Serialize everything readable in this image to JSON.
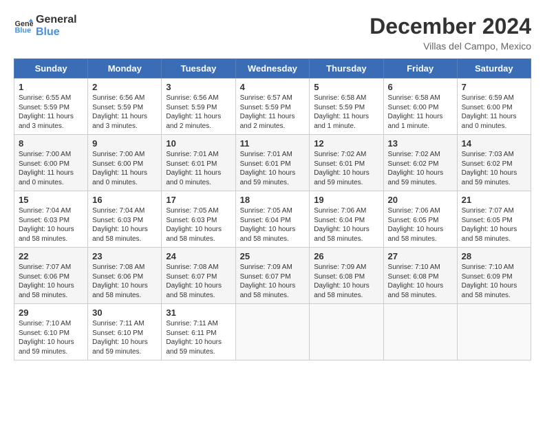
{
  "header": {
    "logo_line1": "General",
    "logo_line2": "Blue",
    "month": "December 2024",
    "location": "Villas del Campo, Mexico"
  },
  "weekdays": [
    "Sunday",
    "Monday",
    "Tuesday",
    "Wednesday",
    "Thursday",
    "Friday",
    "Saturday"
  ],
  "weeks": [
    [
      {
        "day": "1",
        "info": "Sunrise: 6:55 AM\nSunset: 5:59 PM\nDaylight: 11 hours\nand 3 minutes."
      },
      {
        "day": "2",
        "info": "Sunrise: 6:56 AM\nSunset: 5:59 PM\nDaylight: 11 hours\nand 3 minutes."
      },
      {
        "day": "3",
        "info": "Sunrise: 6:56 AM\nSunset: 5:59 PM\nDaylight: 11 hours\nand 2 minutes."
      },
      {
        "day": "4",
        "info": "Sunrise: 6:57 AM\nSunset: 5:59 PM\nDaylight: 11 hours\nand 2 minutes."
      },
      {
        "day": "5",
        "info": "Sunrise: 6:58 AM\nSunset: 5:59 PM\nDaylight: 11 hours\nand 1 minute."
      },
      {
        "day": "6",
        "info": "Sunrise: 6:58 AM\nSunset: 6:00 PM\nDaylight: 11 hours\nand 1 minute."
      },
      {
        "day": "7",
        "info": "Sunrise: 6:59 AM\nSunset: 6:00 PM\nDaylight: 11 hours\nand 0 minutes."
      }
    ],
    [
      {
        "day": "8",
        "info": "Sunrise: 7:00 AM\nSunset: 6:00 PM\nDaylight: 11 hours\nand 0 minutes."
      },
      {
        "day": "9",
        "info": "Sunrise: 7:00 AM\nSunset: 6:00 PM\nDaylight: 11 hours\nand 0 minutes."
      },
      {
        "day": "10",
        "info": "Sunrise: 7:01 AM\nSunset: 6:01 PM\nDaylight: 11 hours\nand 0 minutes."
      },
      {
        "day": "11",
        "info": "Sunrise: 7:01 AM\nSunset: 6:01 PM\nDaylight: 10 hours\nand 59 minutes."
      },
      {
        "day": "12",
        "info": "Sunrise: 7:02 AM\nSunset: 6:01 PM\nDaylight: 10 hours\nand 59 minutes."
      },
      {
        "day": "13",
        "info": "Sunrise: 7:02 AM\nSunset: 6:02 PM\nDaylight: 10 hours\nand 59 minutes."
      },
      {
        "day": "14",
        "info": "Sunrise: 7:03 AM\nSunset: 6:02 PM\nDaylight: 10 hours\nand 59 minutes."
      }
    ],
    [
      {
        "day": "15",
        "info": "Sunrise: 7:04 AM\nSunset: 6:03 PM\nDaylight: 10 hours\nand 58 minutes."
      },
      {
        "day": "16",
        "info": "Sunrise: 7:04 AM\nSunset: 6:03 PM\nDaylight: 10 hours\nand 58 minutes."
      },
      {
        "day": "17",
        "info": "Sunrise: 7:05 AM\nSunset: 6:03 PM\nDaylight: 10 hours\nand 58 minutes."
      },
      {
        "day": "18",
        "info": "Sunrise: 7:05 AM\nSunset: 6:04 PM\nDaylight: 10 hours\nand 58 minutes."
      },
      {
        "day": "19",
        "info": "Sunrise: 7:06 AM\nSunset: 6:04 PM\nDaylight: 10 hours\nand 58 minutes."
      },
      {
        "day": "20",
        "info": "Sunrise: 7:06 AM\nSunset: 6:05 PM\nDaylight: 10 hours\nand 58 minutes."
      },
      {
        "day": "21",
        "info": "Sunrise: 7:07 AM\nSunset: 6:05 PM\nDaylight: 10 hours\nand 58 minutes."
      }
    ],
    [
      {
        "day": "22",
        "info": "Sunrise: 7:07 AM\nSunset: 6:06 PM\nDaylight: 10 hours\nand 58 minutes."
      },
      {
        "day": "23",
        "info": "Sunrise: 7:08 AM\nSunset: 6:06 PM\nDaylight: 10 hours\nand 58 minutes."
      },
      {
        "day": "24",
        "info": "Sunrise: 7:08 AM\nSunset: 6:07 PM\nDaylight: 10 hours\nand 58 minutes."
      },
      {
        "day": "25",
        "info": "Sunrise: 7:09 AM\nSunset: 6:07 PM\nDaylight: 10 hours\nand 58 minutes."
      },
      {
        "day": "26",
        "info": "Sunrise: 7:09 AM\nSunset: 6:08 PM\nDaylight: 10 hours\nand 58 minutes."
      },
      {
        "day": "27",
        "info": "Sunrise: 7:10 AM\nSunset: 6:08 PM\nDaylight: 10 hours\nand 58 minutes."
      },
      {
        "day": "28",
        "info": "Sunrise: 7:10 AM\nSunset: 6:09 PM\nDaylight: 10 hours\nand 58 minutes."
      }
    ],
    [
      {
        "day": "29",
        "info": "Sunrise: 7:10 AM\nSunset: 6:10 PM\nDaylight: 10 hours\nand 59 minutes."
      },
      {
        "day": "30",
        "info": "Sunrise: 7:11 AM\nSunset: 6:10 PM\nDaylight: 10 hours\nand 59 minutes."
      },
      {
        "day": "31",
        "info": "Sunrise: 7:11 AM\nSunset: 6:11 PM\nDaylight: 10 hours\nand 59 minutes."
      },
      {
        "day": "",
        "info": ""
      },
      {
        "day": "",
        "info": ""
      },
      {
        "day": "",
        "info": ""
      },
      {
        "day": "",
        "info": ""
      }
    ]
  ]
}
